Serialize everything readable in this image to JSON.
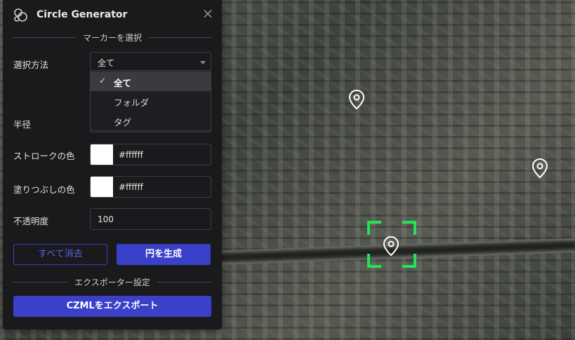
{
  "app": {
    "title": "Circle Generator",
    "close_symbol": "×",
    "logo_icon": "circles-logo-icon",
    "close_icon": "close-icon"
  },
  "marker_section": {
    "title": "マーカーを選択"
  },
  "selection": {
    "label": "選択方法",
    "current_value": "全て",
    "options": [
      {
        "label": "全て",
        "selected": true
      },
      {
        "label": "フォルダ",
        "selected": false
      },
      {
        "label": "タグ",
        "selected": false
      }
    ],
    "check_symbol": "✓"
  },
  "radius": {
    "label": "半径",
    "value": ""
  },
  "stroke": {
    "label": "ストロークの色",
    "hex": "#ffffff",
    "swatch_color": "#ffffff"
  },
  "fill": {
    "label": "塗りつぶしの色",
    "hex": "#ffffff",
    "swatch_color": "#ffffff"
  },
  "opacity": {
    "label": "不透明度",
    "value": "100"
  },
  "buttons": {
    "clear_all": "すべて消去",
    "generate": "円を生成"
  },
  "export_section": {
    "title": "エクスポーター設定",
    "export_button": "CZMLをエクスポート"
  },
  "colors": {
    "accent": "#3b40c9",
    "panel_bg": "#1a1a1d",
    "focus_frame": "#22e35a"
  },
  "map": {
    "marker_icon": "map-pin-icon",
    "marker_count": 3
  }
}
